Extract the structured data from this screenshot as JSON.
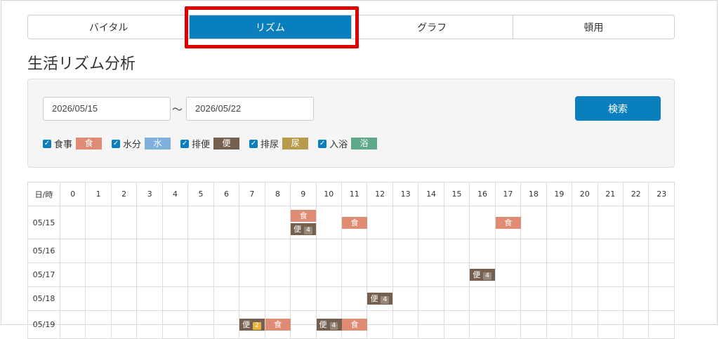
{
  "tabs": [
    {
      "label": "バイタル",
      "active": false
    },
    {
      "label": "リズム",
      "active": true
    },
    {
      "label": "グラフ",
      "active": false
    },
    {
      "label": "頓用",
      "active": false
    }
  ],
  "page_title": "生活リズム分析",
  "filter": {
    "date_from": "2026/05/15",
    "separator": "～",
    "date_to": "2026/05/22",
    "search_label": "検索",
    "categories": [
      {
        "label": "食事",
        "tag": "食",
        "color": "#e08c74",
        "checked": true
      },
      {
        "label": "水分",
        "tag": "水",
        "color": "#7fb0de",
        "checked": true
      },
      {
        "label": "排便",
        "tag": "便",
        "color": "#75604f",
        "checked": true
      },
      {
        "label": "排尿",
        "tag": "尿",
        "color": "#b89a4b",
        "checked": true
      },
      {
        "label": "入浴",
        "tag": "浴",
        "color": "#5fa88a",
        "checked": true
      }
    ]
  },
  "grid": {
    "corner_label": "日/時",
    "hours": [
      "0",
      "1",
      "2",
      "3",
      "4",
      "5",
      "6",
      "7",
      "8",
      "9",
      "10",
      "11",
      "12",
      "13",
      "14",
      "15",
      "16",
      "17",
      "18",
      "19",
      "20",
      "21",
      "22",
      "23"
    ],
    "rows": [
      {
        "date": "05/15",
        "marks": [
          {
            "hour": 9,
            "items": [
              {
                "type": "food",
                "label": "食"
              },
              {
                "type": "stool",
                "label": "便",
                "count": "4"
              }
            ]
          },
          {
            "hour": 11,
            "items": [
              {
                "type": "food",
                "label": "食"
              }
            ]
          },
          {
            "hour": 17,
            "items": [
              {
                "type": "food",
                "label": "食"
              }
            ]
          }
        ]
      },
      {
        "date": "05/16",
        "marks": []
      },
      {
        "date": "05/17",
        "marks": [
          {
            "hour": 16,
            "items": [
              {
                "type": "stool",
                "label": "便",
                "count": "4"
              }
            ]
          }
        ]
      },
      {
        "date": "05/18",
        "marks": [
          {
            "hour": 12,
            "items": [
              {
                "type": "stool",
                "label": "便",
                "count": "4"
              }
            ]
          }
        ]
      },
      {
        "date": "05/19",
        "marks": [
          {
            "hour": 7,
            "items": [
              {
                "type": "stool",
                "label": "便",
                "count": "2"
              }
            ]
          },
          {
            "hour": 8,
            "items": [
              {
                "type": "food",
                "label": "食"
              }
            ]
          },
          {
            "hour": 10,
            "items": [
              {
                "type": "stool",
                "label": "便",
                "count": "4"
              }
            ]
          },
          {
            "hour": 11,
            "items": [
              {
                "type": "food",
                "label": "食"
              }
            ]
          }
        ]
      }
    ]
  }
}
